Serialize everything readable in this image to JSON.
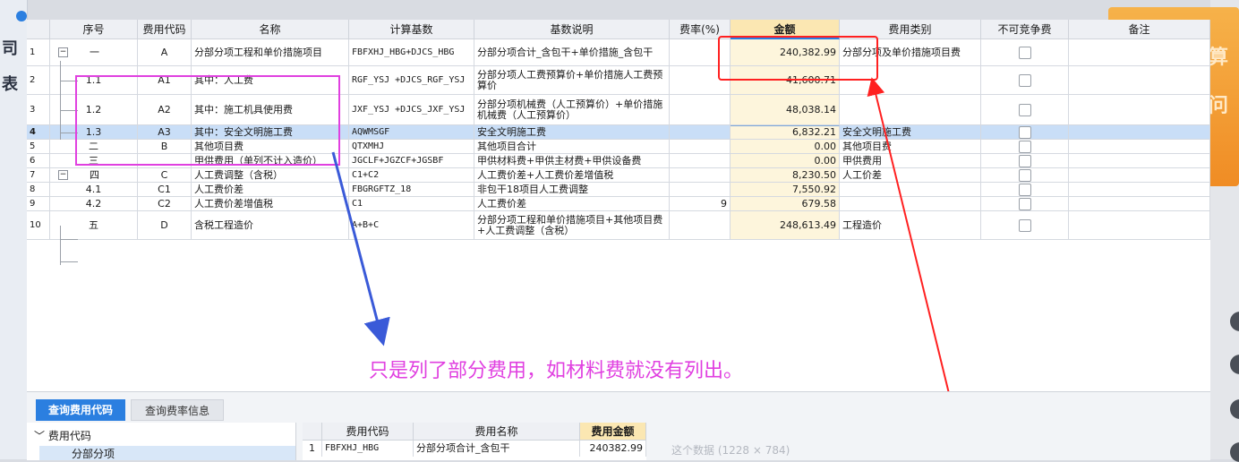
{
  "grid": {
    "headers": [
      "序号",
      "费用代码",
      "名称",
      "计算基数",
      "基数说明",
      "费率(%)",
      "金额",
      "费用类别",
      "不可竞争费",
      "备注"
    ],
    "rows": [
      {
        "row": "1",
        "seq": "一",
        "code": "A",
        "name": "分部分项工程和单价措施项目",
        "base": "FBFXHJ_HBG+DJCS_HBG",
        "desc": "分部分项合计_含包干+单价措施_含包干",
        "rate": "",
        "amount": "240,382.99",
        "category": "分部分项及单价措施项目费",
        "tree": "minus"
      },
      {
        "row": "2",
        "seq": "1.1",
        "code": "A1",
        "name": "其中：人工费",
        "base": "RGF_YSJ +DJCS_RGF_YSJ",
        "desc": "分部分项人工费预算价+单价措施人工费预算价",
        "rate": "",
        "amount": "41,600.71",
        "category": "",
        "tree": "child"
      },
      {
        "row": "3",
        "seq": "1.2",
        "code": "A2",
        "name": "其中：施工机具使用费",
        "base": "JXF_YSJ +DJCS_JXF_YSJ",
        "desc": "分部分项机械费（人工预算价）+单价措施机械费（人工预算价）",
        "rate": "",
        "amount": "48,038.14",
        "category": "",
        "tree": "child"
      },
      {
        "row": "4",
        "seq": "1.3",
        "code": "A3",
        "name": "其中：安全文明施工费",
        "base": "AQWMSGF",
        "desc": "安全文明施工费",
        "rate": "",
        "amount": "6,832.21",
        "category": "安全文明施工费",
        "tree": "child"
      },
      {
        "row": "5",
        "seq": "二",
        "code": "B",
        "name": "其他项目费",
        "base": "QTXMHJ",
        "desc": "其他项目合计",
        "rate": "",
        "amount": "0.00",
        "category": "其他项目费",
        "tree": ""
      },
      {
        "row": "6",
        "seq": "三",
        "code": "",
        "name": "甲供费用（单列不计入造价）",
        "base": "JGCLF+JGZCF+JGSBF",
        "desc": "甲供材料费+甲供主材费+甲供设备费",
        "rate": "",
        "amount": "0.00",
        "category": "甲供费用",
        "tree": ""
      },
      {
        "row": "7",
        "seq": "四",
        "code": "C",
        "name": "人工费调整（含税）",
        "base": "C1+C2",
        "desc": "人工费价差+人工费价差增值税",
        "rate": "",
        "amount": "8,230.50",
        "category": "人工价差",
        "tree": "minus"
      },
      {
        "row": "8",
        "seq": "4.1",
        "code": "C1",
        "name": "人工费价差",
        "base": "FBGRGFTZ_18",
        "desc": "非包干18项目人工费调整",
        "rate": "",
        "amount": "7,550.92",
        "category": "",
        "tree": "child"
      },
      {
        "row": "9",
        "seq": "4.2",
        "code": "C2",
        "name": "人工费价差增值税",
        "base": "C1",
        "desc": "人工费价差",
        "rate": "9",
        "amount": "679.58",
        "category": "",
        "tree": "child"
      },
      {
        "row": "10",
        "seq": "五",
        "code": "D",
        "name": "含税工程造价",
        "base": "A+B+C",
        "desc": "分部分项工程和单价措施项目+其他项目费+人工费调整（含税）",
        "rate": "",
        "amount": "248,613.49",
        "category": "工程造价",
        "tree": ""
      }
    ]
  },
  "annotation": {
    "text": "只是列了部分费用，如材料费就没有列出。"
  },
  "bottom_panel": {
    "tabs": [
      "查询费用代码",
      "查询费率信息"
    ],
    "tree_root": "费用代码",
    "tree_child": "分部分项",
    "sub_headers": [
      "费用代码",
      "费用名称",
      "费用金额"
    ],
    "sub_row": {
      "num": "1",
      "code": "FBFXHJ_HBG",
      "name": "分部分项合计_含包干",
      "amount": "240382.99"
    },
    "overlay_note": "这个数据 (1228 × 784)"
  },
  "colors": {
    "selected_row": "#c9def7",
    "amount_header": "#fbe7b2",
    "annotation_pink": "#e040e0",
    "annotation_red": "#ff2020",
    "tab_blue": "#2b7fe0"
  }
}
